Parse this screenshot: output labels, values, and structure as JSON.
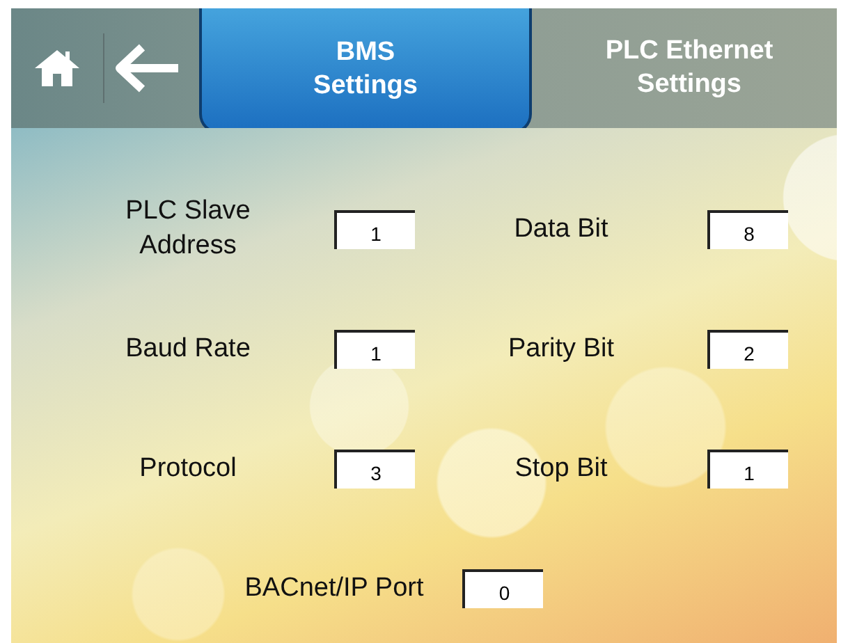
{
  "tabs": [
    {
      "label": "BMS\nSettings",
      "selected": true
    },
    {
      "label": "PLC Ethernet\nSettings",
      "selected": false
    }
  ],
  "fields": [
    {
      "label": "PLC Slave\nAddress",
      "value": "1"
    },
    {
      "label": "Data Bit",
      "value": "8"
    },
    {
      "label": "Baud Rate",
      "value": "1"
    },
    {
      "label": "Parity Bit",
      "value": "2"
    },
    {
      "label": "Protocol",
      "value": "3"
    },
    {
      "label": "Stop Bit",
      "value": "1"
    },
    {
      "label": "BACnet/IP Port",
      "value": "0"
    }
  ]
}
